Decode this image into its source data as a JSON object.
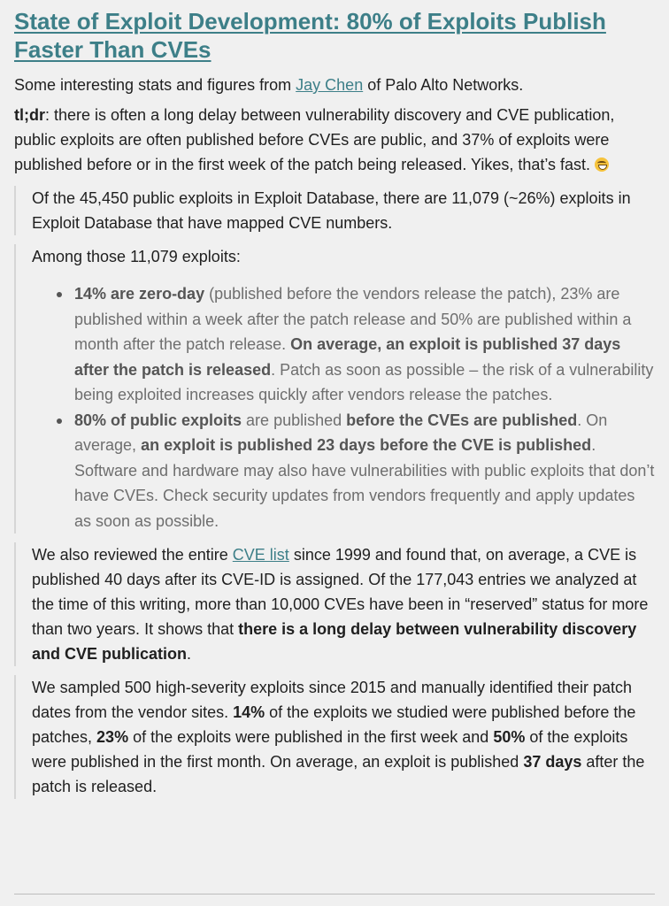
{
  "title": "State of Exploit Development: 80% of Exploits Publish Faster Than CVEs",
  "intro": {
    "before": "Some interesting stats and figures from ",
    "link": "Jay Chen",
    "after": " of Palo Alto Networks."
  },
  "tldr": {
    "label": "tl;dr",
    "text": ": there is often a long delay between vulnerability discovery and CVE publication, public exploits are often published before CVEs are public, and 37% of exploits were published before or in the first week of the patch being released. Yikes, that’s fast. ",
    "emoji_icon": "grinning-sweat-emoji"
  },
  "quote1": "Of the 45,450 public exploits in Exploit Database, there are 11,079 (~26%) exploits in Exploit Database that have mapped CVE numbers.",
  "quote2": {
    "lead": "Among those 11,079 exploits:",
    "item1": {
      "b1": "14% are zero-day",
      "t1": " (published before the vendors release the patch), 23% are published within a week after the patch release and 50% are published within a month after the patch release. ",
      "b2": "On average, an exploit is published 37 days after the patch is released",
      "t2": ". Patch as soon as possible – the risk of a vulnerability being exploited increases quickly after vendors release the patches."
    },
    "item2": {
      "b1": "80% of public exploits",
      "t1": " are published ",
      "b2": "before the CVEs are published",
      "t2": ". On average, ",
      "b3": "an exploit is published 23 days before the CVE is published",
      "t3": ". Software and hardware may also have vulnerabilities with public exploits that don’t have CVEs. Check security updates from vendors frequently and apply updates as soon as possible."
    }
  },
  "quote3": {
    "t1": "We also reviewed the entire ",
    "link": "CVE list",
    "t2": " since 1999 and found that, on average, a CVE is published 40 days after its CVE-ID is assigned. Of the 177,043 entries we analyzed at the time of this writing, more than 10,000 CVEs have been in “reserved” status for more than two years. It shows that ",
    "b1": "there is a long delay between vulnerability discovery and CVE publication",
    "t3": "."
  },
  "quote4": {
    "t1": "We sampled 500 high-severity exploits since 2015 and manually identified their patch dates from the vendor sites. ",
    "b1": "14%",
    "t2": " of the exploits we studied were published before the patches, ",
    "b2": "23%",
    "t3": " of the exploits were published in the first week and ",
    "b3": "50%",
    "t4": " of the exploits were published in the first month. On average, an exploit is published ",
    "b4": "37 days",
    "t5": " after the patch is released."
  }
}
